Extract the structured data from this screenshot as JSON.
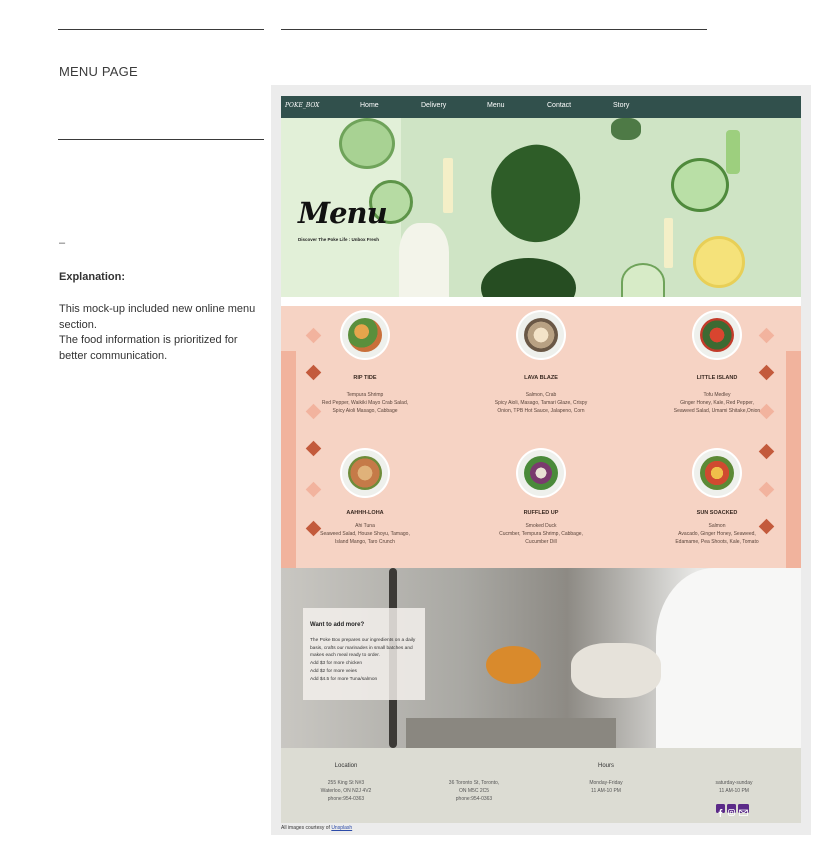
{
  "page": {
    "title": "MENU PAGE",
    "dash": "–",
    "explanation_heading": "Explanation:",
    "explanation_line1": "This mock-up included new online menu section.",
    "explanation_line2": "The food information is prioritized for better communication."
  },
  "site": {
    "logo": "POKE_BOX",
    "nav": [
      "Home",
      "Delivery",
      "Menu",
      "Contact",
      "Story"
    ],
    "hero": {
      "title": "Menu",
      "subtitle": "Discover The Poke Life : Unbox Fresh"
    },
    "menu_items": [
      {
        "name": "RIP TIDE",
        "desc": "Tempura Shrimp\nRed Pepper, Waikiki Mayo Crab Salad,\nSpicy Aioli Masago, Cabbage"
      },
      {
        "name": "LAVA BLAZE",
        "desc": "Salmon, Crab\nSpicy Aioli, Masago, Tamari Glaze, Crispy\nOnion, TPB Hot Sauce, Jalapeno, Corn"
      },
      {
        "name": "LITTLE ISLAND",
        "desc": "Tofu Medley\nGinger Honey, Kale, Red Pepper,\nSeaweed Salad, Umami Shitake,Onion"
      },
      {
        "name": "AAHHH-LOHA",
        "desc": "Ahi Tuna\nSeaweed Salad, House Shoyu, Tamago,\nIsland Mango, Taro Crunch"
      },
      {
        "name": "RUFFLED UP",
        "desc": "Smoked Duck\nCucmber, Tempura Shrimp, Cabbage,\nCucumber Dill"
      },
      {
        "name": "SUN SOACKED",
        "desc": "Salmon\nAvacado, Ginger Honey, Seaweed,\nEdamame, Pea Shoots, Kale, Tomato"
      }
    ],
    "add_more": {
      "heading": "Want to add more?",
      "body": "The Poke Box prepares our ingredients on a daily basis, crafts our marinades in small batches and makes each meal ready to order.\nAdd $3 for more chicken\nAdd $2 for more veies\nAdd $4.5 for more Tuna/salmon"
    },
    "footer": {
      "location_heading": "Location",
      "location1": "255 King St N#3\nWaterloo, ON N2J 4V2\nphone:954-0363",
      "location2": "36 Toronto St, Toronto,\nON M5C 2C5\nphone:954-0363",
      "hours_heading": "Hours",
      "hours1": "Monday-Friday\n11 AM-10 PM",
      "hours2": "saturday-sunday\n11 AM-10 PM"
    },
    "social_icons": [
      "facebook-icon",
      "instagram-icon",
      "mail-icon"
    ],
    "credit_prefix": "All images courtesy of ",
    "credit_link": "Unsplash"
  },
  "colors": {
    "nav": "#31504c",
    "hero": "#cfe4c5",
    "menu_bg": "#f6d3c4",
    "accent_dark": "#c35a3c",
    "accent_light": "#f2b39e",
    "footer": "#dcdcd3",
    "social": "#5b2a88"
  }
}
